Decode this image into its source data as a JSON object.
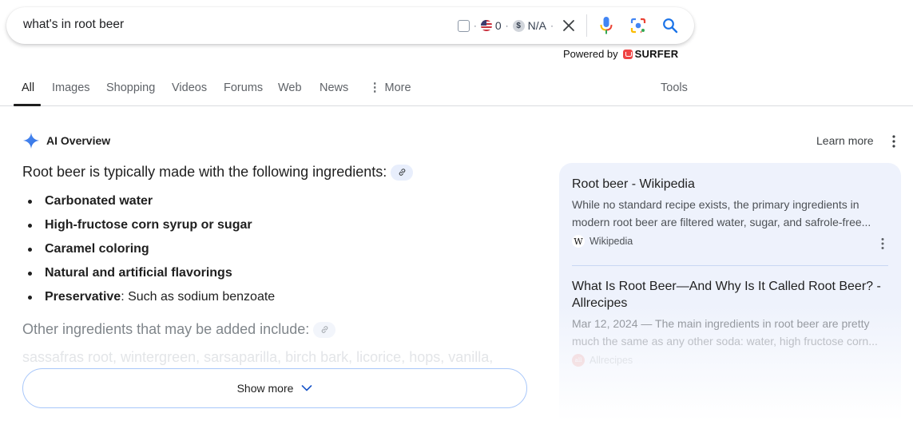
{
  "search": {
    "query": "what's in root beer",
    "extension_stats": {
      "flag_count": "0",
      "dollar_value": "N/A"
    },
    "powered_by_label": "Powered by",
    "powered_by_brand": "SURFER"
  },
  "tabs": [
    {
      "label": "All",
      "active": true
    },
    {
      "label": "Images"
    },
    {
      "label": "Shopping"
    },
    {
      "label": "Videos"
    },
    {
      "label": "Forums"
    },
    {
      "label": "Web"
    },
    {
      "label": "News"
    },
    {
      "label": "More"
    }
  ],
  "tools_label": "Tools",
  "ai_overview": {
    "title": "AI Overview",
    "learn_more": "Learn more",
    "intro": "Root beer is typically made with the following ingredients:",
    "ingredients": [
      {
        "bold": "Carbonated water",
        "rest": ""
      },
      {
        "bold": "High-fructose corn syrup or sugar",
        "rest": ""
      },
      {
        "bold": "Caramel coloring",
        "rest": ""
      },
      {
        "bold": "Natural and artificial flavorings",
        "rest": ""
      },
      {
        "bold": "Preservative",
        "rest": ": Such as sodium benzoate"
      }
    ],
    "other_intro": "Other ingredients that may be added include:",
    "other_list": "sassafras root, wintergreen, sarsaparilla, birch bark, licorice, hops, vanilla,",
    "show_more": "Show more"
  },
  "sources": [
    {
      "title": "Root beer - Wikipedia",
      "snippet_line1": "While no standard recipe exists, the primary ingredients in",
      "snippet_line2": "modern root beer are filtered water, sugar, and safrole-free...",
      "site": "Wikipedia",
      "favicon": "W"
    },
    {
      "title_line1": "What Is Root Beer—And Why Is It Called Root Beer? -",
      "title_line2": "Allrecipes",
      "snippet_line1": "Mar 12, 2024 — The main ingredients in root beer are pretty",
      "snippet_line2": "much the same as any other soda: water, high fructose corn...",
      "site": "Allrecipes",
      "favicon": "all"
    }
  ],
  "colors": {
    "accent_blue": "#1a73e8",
    "sources_bg": "#eef2fc",
    "show_more_border": "#a8c7fa"
  }
}
